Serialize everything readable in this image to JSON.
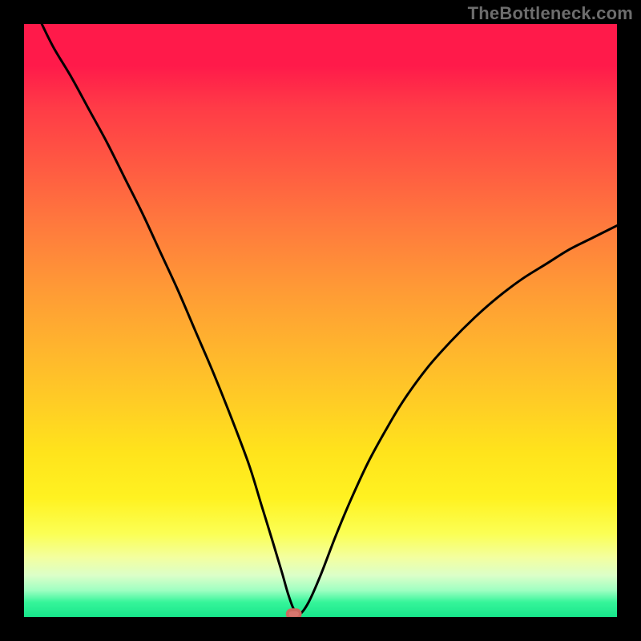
{
  "watermark": "TheBottleneck.com",
  "chart_data": {
    "type": "line",
    "title": "",
    "xlabel": "",
    "ylabel": "",
    "xlim": [
      0,
      100
    ],
    "ylim": [
      0,
      100
    ],
    "grid": false,
    "series": [
      {
        "name": "bottleneck-curve",
        "x": [
          3,
          5,
          8,
          11,
          14,
          17,
          20,
          23,
          26,
          29,
          32,
          35,
          38,
          40,
          42,
          43.5,
          44.5,
          45.5,
          46.5,
          48,
          50,
          52.5,
          55,
          58,
          61,
          64,
          68,
          72,
          76,
          80,
          84,
          88,
          92,
          96,
          100
        ],
        "y": [
          100,
          96,
          91,
          85.5,
          80,
          74,
          68,
          61.5,
          55,
          48,
          41,
          33.5,
          25.5,
          19,
          12.5,
          7.5,
          4,
          1.3,
          0.5,
          2.5,
          7,
          13.5,
          19.5,
          26,
          31.5,
          36.5,
          42,
          46.5,
          50.5,
          54,
          57,
          59.5,
          62,
          64,
          66
        ]
      }
    ],
    "marker": {
      "x": 45.5,
      "y": 0.5,
      "shape": "rounded-rect",
      "color": "#d8766e"
    },
    "background_gradient": {
      "top": "#ff1a4a",
      "bottom": "#17e68b",
      "stops": [
        "red",
        "orange",
        "yellow",
        "green"
      ]
    }
  }
}
